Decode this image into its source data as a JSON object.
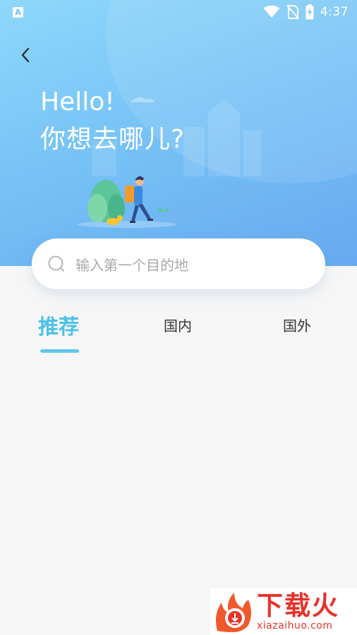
{
  "status_bar": {
    "app_badge": "A",
    "time": "4:37",
    "icons": [
      "wifi-icon",
      "no-sim-icon",
      "battery-charging-icon"
    ]
  },
  "hero": {
    "greeting_line1": "Hello!",
    "greeting_line2": "你想去哪儿?",
    "back_icon": "chevron-left-icon"
  },
  "search": {
    "placeholder": "输入第一个目的地",
    "icon": "search-icon"
  },
  "tabs": [
    {
      "label": "推荐",
      "active": true
    },
    {
      "label": "国内",
      "active": false
    },
    {
      "label": "国外",
      "active": false
    }
  ],
  "watermark": {
    "title": "下载火",
    "subtitle": "xiazaihuo.com"
  },
  "colors": {
    "accent": "#4cc1e8",
    "hero_top": "#8ed8fb",
    "hero_bottom": "#67a9f0",
    "background": "#f6f6f6",
    "watermark_red": "#e8332b"
  }
}
